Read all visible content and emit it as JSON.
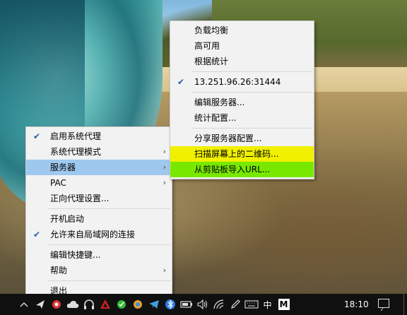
{
  "main_menu": {
    "items": [
      {
        "label": "启用系统代理",
        "checked": true,
        "submenu": false
      },
      {
        "label": "系统代理模式",
        "checked": false,
        "submenu": true
      },
      {
        "label": "服务器",
        "checked": false,
        "submenu": true,
        "highlighted": true
      },
      {
        "label": "PAC",
        "checked": false,
        "submenu": true
      },
      {
        "label": "正向代理设置...",
        "checked": false,
        "submenu": false
      },
      {
        "label": "开机启动",
        "checked": false,
        "submenu": false
      },
      {
        "label": "允许来自局域网的连接",
        "checked": true,
        "submenu": false
      },
      {
        "label": "编辑快捷键...",
        "checked": false,
        "submenu": false
      },
      {
        "label": "帮助",
        "checked": false,
        "submenu": true
      },
      {
        "label": "退出",
        "checked": false,
        "submenu": false
      }
    ]
  },
  "server_menu": {
    "items": [
      {
        "label": "负载均衡"
      },
      {
        "label": "高可用"
      },
      {
        "label": "根据统计"
      },
      {
        "label": "13.251.96.26:31444",
        "checked": true
      },
      {
        "label": "编辑服务器..."
      },
      {
        "label": "统计配置..."
      },
      {
        "label": "分享服务器配置..."
      },
      {
        "label": "扫描屏幕上的二维码...",
        "highlight_color": "#f0f000"
      },
      {
        "label": "从剪贴板导入URL...",
        "highlight_color": "#78e800"
      }
    ]
  },
  "taskbar": {
    "icons": [
      "chevron-up-icon",
      "shadowsocks-icon",
      "cloud-icon",
      "headphones-icon",
      "red-app-icon",
      "green-app-icon",
      "orange-app-icon",
      "telegram-icon",
      "bluetooth-icon",
      "battery-icon",
      "volume-icon",
      "wifi-icon",
      "pen-icon",
      "keyboard-icon"
    ],
    "ime_label": "中",
    "m_label": "M",
    "time": "18:10"
  },
  "colors": {
    "menu_bg": "#f2f2f2",
    "hover_highlight": "#9fc8ef",
    "scan_qr_highlight": "#f0f000",
    "import_url_highlight": "#78e800",
    "taskbar_bg": "#101010"
  }
}
